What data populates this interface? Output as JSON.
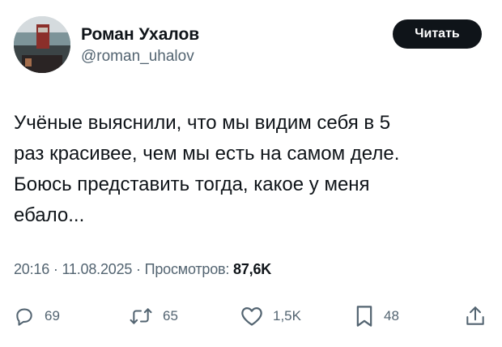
{
  "author": {
    "display_name": "Роман Ухалов",
    "handle": "@roman_uhalov"
  },
  "follow_button": {
    "label": "Читать"
  },
  "tweet": {
    "text": "Учёные выяснили, что мы видим себя в 5\nраз красивее, чем мы есть на самом деле.\nБоюсь представить тогда, какое у меня\nебало..."
  },
  "meta": {
    "time": "20:16",
    "separator": " · ",
    "date": "11.08.2025",
    "views_label": "Просмотров: ",
    "views_count": "87,6K"
  },
  "actions": {
    "replies": "69",
    "retweets": "65",
    "likes": "1,5K",
    "bookmarks": "48"
  },
  "icons": {
    "reply": "reply-icon",
    "retweet": "retweet-icon",
    "like": "heart-icon",
    "bookmark": "bookmark-icon",
    "share": "share-icon"
  },
  "colors": {
    "text": "#0f1419",
    "secondary": "#536471",
    "button_bg": "#0f1419",
    "button_text": "#ffffff",
    "background": "#ffffff"
  }
}
